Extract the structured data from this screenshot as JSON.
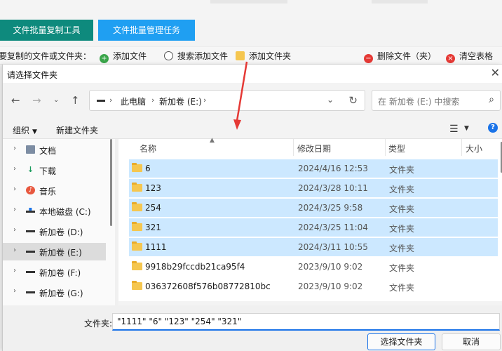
{
  "app": {
    "tabs": [
      "文件批量复制工具",
      "文件批量管理任务"
    ],
    "toolbar": {
      "label": "要复制的文件或文件夹：",
      "add_file": "添加文件",
      "search_add": "搜索添加文件",
      "add_folder": "添加文件夹",
      "delete_file": "删除文件（夹）",
      "clear_table": "清空表格"
    }
  },
  "dialog": {
    "title": "请选择文件夹",
    "address": {
      "segments": [
        "此电脑",
        "新加卷 (E:)"
      ]
    },
    "search_placeholder": "在 新加卷 (E:) 中搜索",
    "commands": {
      "organize": "组织",
      "new_folder": "新建文件夹"
    },
    "nav_items": [
      {
        "label": "文档",
        "icon": "document-icon"
      },
      {
        "label": "下载",
        "icon": "download-icon"
      },
      {
        "label": "音乐",
        "icon": "music-icon"
      },
      {
        "label": "本地磁盘 (C:)",
        "icon": "windows-drive-icon"
      },
      {
        "label": "新加卷 (D:)",
        "icon": "drive-icon"
      },
      {
        "label": "新加卷 (E:)",
        "icon": "drive-icon",
        "selected": true
      },
      {
        "label": "新加卷 (F:)",
        "icon": "drive-icon"
      },
      {
        "label": "新加卷 (G:)",
        "icon": "drive-icon"
      }
    ],
    "columns": {
      "name": "名称",
      "date": "修改日期",
      "type": "类型",
      "size": "大小"
    },
    "files": [
      {
        "name": "6",
        "date": "2024/4/16 12:53",
        "type": "文件夹",
        "selected": true
      },
      {
        "name": "123",
        "date": "2024/3/28 10:11",
        "type": "文件夹",
        "selected": true
      },
      {
        "name": "254",
        "date": "2024/3/25 9:58",
        "type": "文件夹",
        "selected": true
      },
      {
        "name": "321",
        "date": "2024/3/25 11:04",
        "type": "文件夹",
        "selected": true
      },
      {
        "name": "1111",
        "date": "2024/3/11 10:55",
        "type": "文件夹",
        "selected": true
      },
      {
        "name": "9918b29fccdb21ca95f4",
        "date": "2023/9/10 9:02",
        "type": "文件夹",
        "selected": false
      },
      {
        "name": "036372608f576b08772810bc",
        "date": "2023/9/10 9:02",
        "type": "文件夹",
        "selected": false
      }
    ],
    "filename_label": "文件夹:",
    "filename_value": "\"1111\" \"6\" \"123\" \"254\" \"321\"",
    "ok_button": "选择文件夹",
    "cancel_button": "取消"
  },
  "colors": {
    "teal_tab": "#0e8a7d",
    "blue_tab": "#1f9ff2",
    "selection": "#cce8ff",
    "annotation_arrow": "#e53935"
  }
}
